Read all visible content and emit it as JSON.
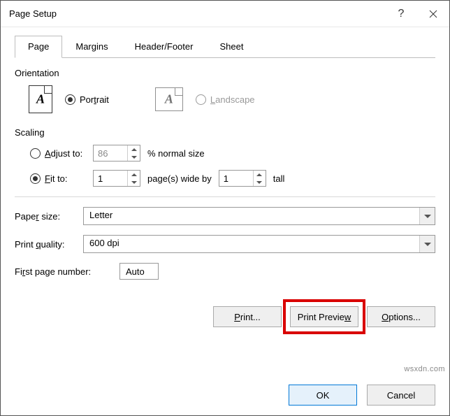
{
  "title": "Page Setup",
  "tabs": {
    "page": "Page",
    "margins": "Margins",
    "headerfooter": "Header/Footer",
    "sheet": "Sheet"
  },
  "orientation": {
    "section": "Orientation",
    "portrait": "Portrait",
    "landscape": "Landscape",
    "iconLetter": "A",
    "selected": "portrait"
  },
  "scaling": {
    "section": "Scaling",
    "adjustTo": "Adjust to:",
    "adjustValue": "86",
    "adjustSuffix": "% normal size",
    "fitTo": "Fit to:",
    "fitWide": "1",
    "fitWideSuffix": "page(s) wide by",
    "fitTall": "1",
    "fitTallSuffix": "tall",
    "selected": "fit"
  },
  "paperSize": {
    "label": "Paper size:",
    "value": "Letter"
  },
  "printQuality": {
    "label": "Print quality:",
    "value": "600 dpi"
  },
  "firstPage": {
    "label": "First page number:",
    "value": "Auto"
  },
  "buttons": {
    "print": "Print...",
    "printPreview": "Print Preview",
    "options": "Options...",
    "ok": "OK",
    "cancel": "Cancel"
  },
  "watermark": "wsxdn.com"
}
